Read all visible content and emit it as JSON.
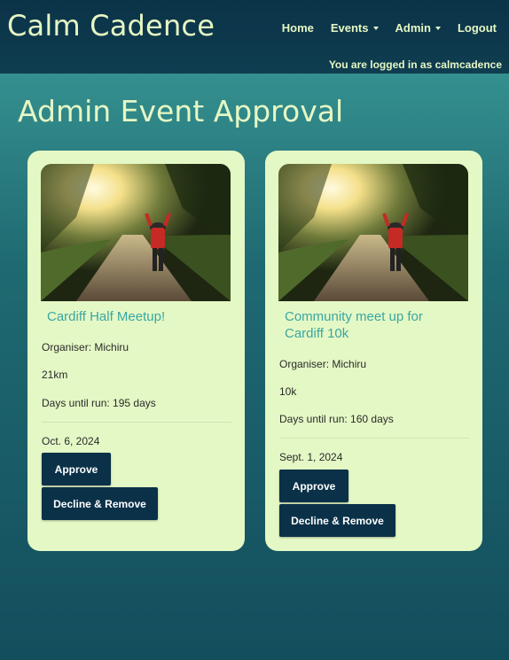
{
  "nav": {
    "brand": "Calm Cadence",
    "links": [
      {
        "label": "Home",
        "dropdown": false
      },
      {
        "label": "Events",
        "dropdown": true
      },
      {
        "label": "Admin",
        "dropdown": true
      },
      {
        "label": "Logout",
        "dropdown": false
      }
    ],
    "login_status": "You are logged in as calmcadence"
  },
  "page": {
    "title": "Admin Event Approval"
  },
  "events": [
    {
      "title": "Cardiff Half Meetup!",
      "organiser": "Organiser: Michiru",
      "distance": "21km",
      "days_until": "Days until run: 195 days",
      "date": "Oct. 6, 2024",
      "approve_label": "Approve",
      "decline_label": "Decline & Remove"
    },
    {
      "title": "Community meet up for Cardiff 10k",
      "organiser": "Organiser: Michiru",
      "distance": "10k",
      "days_until": "Days until run: 160 days",
      "date": "Sept. 1, 2024",
      "approve_label": "Approve",
      "decline_label": "Decline & Remove"
    }
  ],
  "colors": {
    "nav_bg": "#0b3348",
    "brand_text": "#e6f7c4",
    "card_bg": "#e4f8c5",
    "card_title": "#3aa6a2",
    "button_bg": "#0a3148"
  }
}
